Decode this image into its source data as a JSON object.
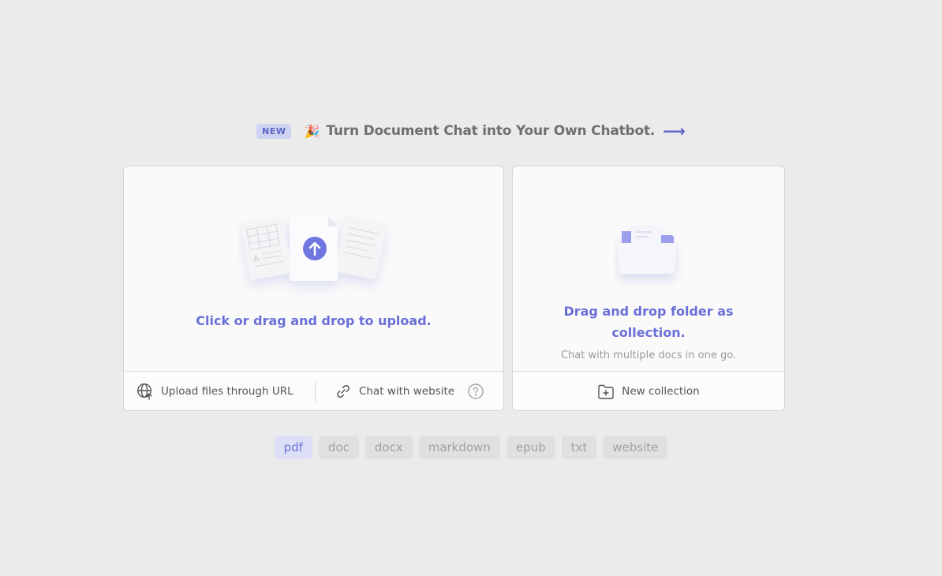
{
  "announcement": {
    "badge": "NEW",
    "emoji": "🎉",
    "text": "Turn Document Chat into Your Own Chatbot.",
    "arrow": "⟶"
  },
  "upload_card": {
    "title": "Click or drag and drop to upload.",
    "url_label": "Upload files through URL",
    "website_label": "Chat with website"
  },
  "collection_card": {
    "title": "Drag and drop folder as collection.",
    "subtitle": "Chat with multiple docs in one go.",
    "new_label": "New collection"
  },
  "file_types": [
    "pdf",
    "doc",
    "docx",
    "markdown",
    "epub",
    "txt",
    "website"
  ],
  "active_type": "pdf",
  "colors": {
    "accent": "#6a6fd8",
    "background": "#ebebeb",
    "card": "#fafafa"
  }
}
